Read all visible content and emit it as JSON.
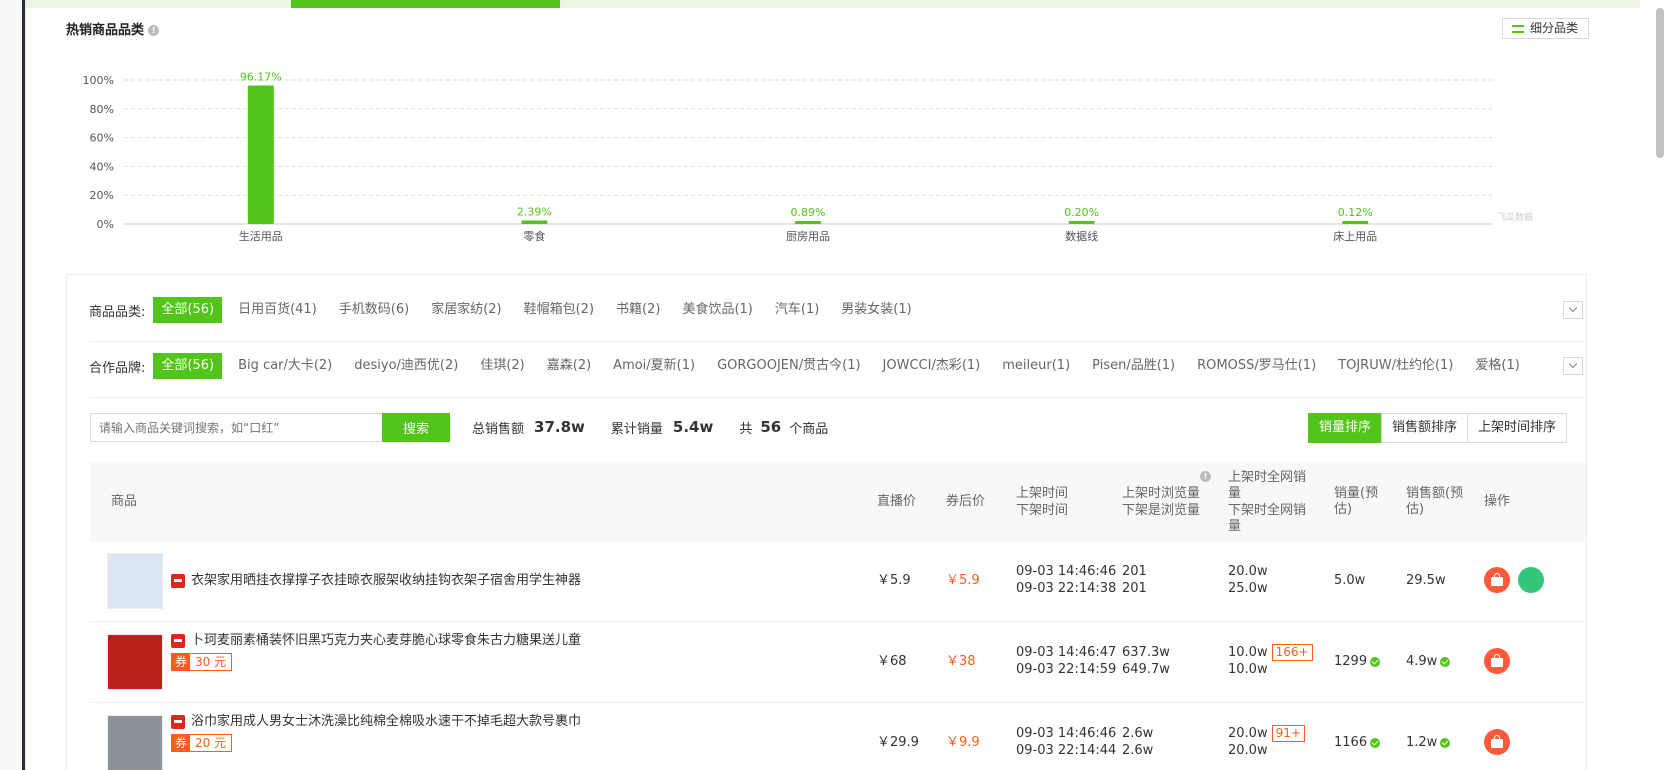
{
  "section": {
    "title": "热销商品品类",
    "subcat_button": "细分品类"
  },
  "watermark": "飞瓜数据",
  "chart_data": {
    "type": "bar",
    "categories": [
      "生活用品",
      "零食",
      "厨房用品",
      "数据线",
      "床上用品"
    ],
    "values": [
      96.17,
      2.39,
      0.89,
      0.2,
      0.12
    ],
    "value_labels": [
      "96.17%",
      "2.39%",
      "0.89%",
      "0.20%",
      "0.12%"
    ],
    "yticks": [
      "0%",
      "20%",
      "40%",
      "60%",
      "80%",
      "100%"
    ],
    "ylim": [
      0,
      100
    ],
    "grid": true,
    "color": "#52c41a"
  },
  "filters": {
    "category_label": "商品品类:",
    "categories": [
      "全部(56)",
      "日用百货(41)",
      "手机数码(6)",
      "家居家纺(2)",
      "鞋帽箱包(2)",
      "书籍(2)",
      "美食饮品(1)",
      "汽车(1)",
      "男装女装(1)"
    ],
    "brand_label": "合作品牌:",
    "brands": [
      "全部(56)",
      "Big car/大卡(2)",
      "desiyo/迪西优(2)",
      "佳琪(2)",
      "嘉森(2)",
      "Amoi/夏新(1)",
      "GORGOOJEN/贯古今(1)",
      "JOWCCI/杰彩(1)",
      "meileur(1)",
      "Pisen/品胜(1)",
      "ROMOSS/罗马仕(1)",
      "TOJRUW/杜约伦(1)",
      "爱格(1)"
    ]
  },
  "search": {
    "placeholder": "请输入商品关键词搜索，如“口红”",
    "button": "搜索"
  },
  "stats": {
    "total_sales_label": "总销售额",
    "total_sales": "37.8w",
    "total_volume_label": "累计销量",
    "total_volume": "5.4w",
    "count_prefix": "共",
    "count": "56",
    "count_suffix": "个商品"
  },
  "sort": [
    "销量排序",
    "销售额排序",
    "上架时间排序"
  ],
  "table": {
    "headers": {
      "product": "商品",
      "live_price": "直播价",
      "coupon_price": "券后价",
      "on_time": "上架时间",
      "off_time": "下架时间",
      "on_views": "上架时浏览量",
      "off_views": "下架是浏览量",
      "on_sales_net": "上架时全网销量",
      "off_sales_net": "下架时全网销量",
      "sales_est": "销量(预估)",
      "revenue_est": "销售额(预估)",
      "ops": "操作"
    },
    "rows": [
      {
        "title": "衣架家用晒挂衣撑撑子衣挂晾衣服架收纳挂钩衣架子宿舍用学生神器",
        "coupon": "",
        "live_price": "￥5.9",
        "coupon_price": "￥5.9",
        "on_time": "09-03 14:46:46",
        "off_time": "09-03 22:14:38",
        "on_views": "201",
        "off_views": "201",
        "on_net": "20.0w",
        "off_net": "25.0w",
        "net_badge": "",
        "sales": "5.0w",
        "revenue": "29.5w"
      },
      {
        "title": "卜珂麦丽素桶装怀旧黑巧克力夹心麦芽脆心球零食朱古力糖果送儿童",
        "coupon": "30 元",
        "live_price": "￥68",
        "coupon_price": "￥38",
        "on_time": "09-03 14:46:47",
        "off_time": "09-03 22:14:59",
        "on_views": "637.3w",
        "off_views": "649.7w",
        "on_net": "10.0w",
        "off_net": "10.0w",
        "net_badge": "166+",
        "sales": "1299",
        "revenue": "4.9w"
      },
      {
        "title": "浴巾家用成人男女士沐洗澡比纯棉全棉吸水速干不掉毛超大款号裹巾",
        "coupon": "20 元",
        "live_price": "￥29.9",
        "coupon_price": "￥9.9",
        "on_time": "09-03 14:46:46",
        "off_time": "09-03 22:14:44",
        "on_views": "2.6w",
        "off_views": "2.6w",
        "on_net": "20.0w",
        "off_net": "20.0w",
        "net_badge": "91+",
        "sales": "1166",
        "revenue": "1.2w"
      }
    ],
    "coupon_mark": "券"
  }
}
